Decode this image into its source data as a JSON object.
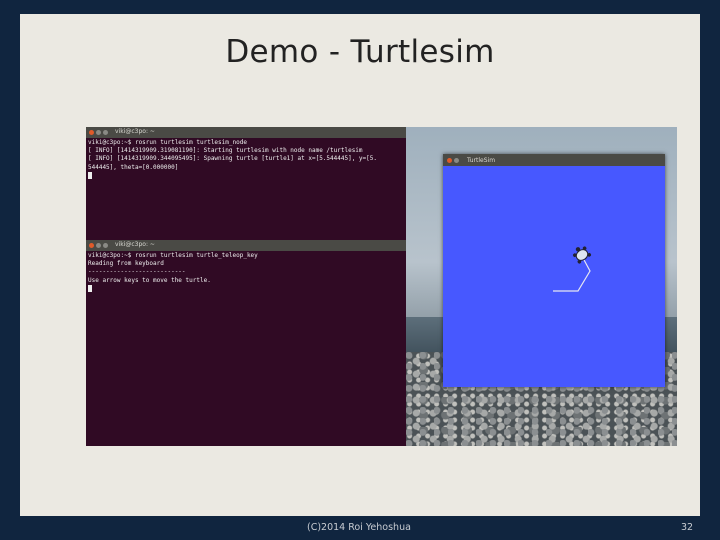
{
  "slide": {
    "title": "Demo - Turtlesim",
    "footer_text": "(C)2014 Roi Yehoshua",
    "page_number": "32"
  },
  "terminal_top": {
    "title": "viki@c3po: ~",
    "lines": [
      "viki@c3po:~$ rosrun turtlesim turtlesim_node",
      "[ INFO] [1414319909.319081190]: Starting turtlesim with node name /turtlesim",
      "[ INFO] [1414319909.344095495]: Spawning turtle [turtle1] at x=[5.544445], y=[5.",
      "544445], theta=[0.000000]"
    ]
  },
  "terminal_bottom": {
    "title": "viki@c3po: ~",
    "lines": [
      "viki@c3po:~$ rosrun turtlesim turtle_teleop_key",
      "Reading from keyboard",
      "---------------------------",
      "Use arrow keys to move the turtle."
    ]
  },
  "turtlesim_window": {
    "title": "TurtleSim",
    "background_color": "#4758ff"
  },
  "colors": {
    "frame": "#10253f",
    "slide_bg": "#ebe9e2",
    "terminal_bg": "#300a24"
  }
}
